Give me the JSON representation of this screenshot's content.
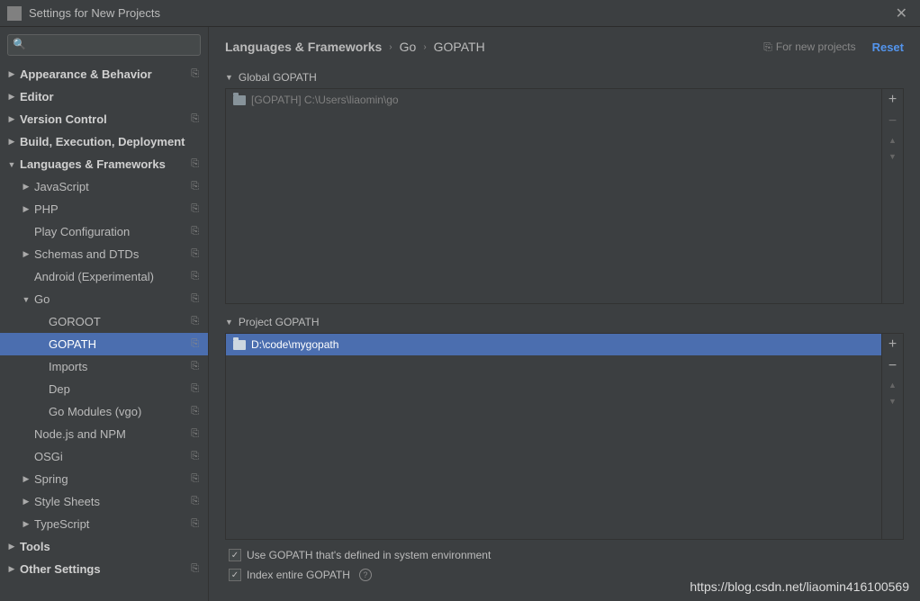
{
  "titlebar": {
    "title": "Settings for New Projects"
  },
  "search": {
    "placeholder": ""
  },
  "tree": [
    {
      "label": "Appearance & Behavior",
      "bold": true,
      "arrow": "▶",
      "indent": 0,
      "copy": true
    },
    {
      "label": "Editor",
      "bold": true,
      "arrow": "▶",
      "indent": 0,
      "copy": false
    },
    {
      "label": "Version Control",
      "bold": true,
      "arrow": "▶",
      "indent": 0,
      "copy": true
    },
    {
      "label": "Build, Execution, Deployment",
      "bold": true,
      "arrow": "▶",
      "indent": 0,
      "copy": false
    },
    {
      "label": "Languages & Frameworks",
      "bold": true,
      "arrow": "▼",
      "indent": 0,
      "copy": true
    },
    {
      "label": "JavaScript",
      "bold": false,
      "arrow": "▶",
      "indent": 1,
      "copy": true
    },
    {
      "label": "PHP",
      "bold": false,
      "arrow": "▶",
      "indent": 1,
      "copy": true
    },
    {
      "label": "Play Configuration",
      "bold": false,
      "arrow": "",
      "indent": 1,
      "copy": true
    },
    {
      "label": "Schemas and DTDs",
      "bold": false,
      "arrow": "▶",
      "indent": 1,
      "copy": true
    },
    {
      "label": "Android (Experimental)",
      "bold": false,
      "arrow": "",
      "indent": 1,
      "copy": true
    },
    {
      "label": "Go",
      "bold": false,
      "arrow": "▼",
      "indent": 1,
      "copy": true
    },
    {
      "label": "GOROOT",
      "bold": false,
      "arrow": "",
      "indent": 2,
      "copy": true
    },
    {
      "label": "GOPATH",
      "bold": false,
      "arrow": "",
      "indent": 2,
      "copy": true,
      "selected": true
    },
    {
      "label": "Imports",
      "bold": false,
      "arrow": "",
      "indent": 2,
      "copy": true
    },
    {
      "label": "Dep",
      "bold": false,
      "arrow": "",
      "indent": 2,
      "copy": true
    },
    {
      "label": "Go Modules (vgo)",
      "bold": false,
      "arrow": "",
      "indent": 2,
      "copy": true
    },
    {
      "label": "Node.js and NPM",
      "bold": false,
      "arrow": "",
      "indent": 1,
      "copy": true
    },
    {
      "label": "OSGi",
      "bold": false,
      "arrow": "",
      "indent": 1,
      "copy": true
    },
    {
      "label": "Spring",
      "bold": false,
      "arrow": "▶",
      "indent": 1,
      "copy": true
    },
    {
      "label": "Style Sheets",
      "bold": false,
      "arrow": "▶",
      "indent": 1,
      "copy": true
    },
    {
      "label": "TypeScript",
      "bold": false,
      "arrow": "▶",
      "indent": 1,
      "copy": true
    },
    {
      "label": "Tools",
      "bold": true,
      "arrow": "▶",
      "indent": 0,
      "copy": false
    },
    {
      "label": "Other Settings",
      "bold": true,
      "arrow": "▶",
      "indent": 0,
      "copy": true
    }
  ],
  "breadcrumb": {
    "p0": "Languages & Frameworks",
    "p1": "Go",
    "p2": "GOPATH"
  },
  "header": {
    "for_new": "For new projects",
    "reset": "Reset"
  },
  "global": {
    "title": "Global GOPATH",
    "items": [
      {
        "label": "[GOPATH] C:\\Users\\liaomin\\go",
        "selected": false
      }
    ]
  },
  "project": {
    "title": "Project GOPATH",
    "items": [
      {
        "label": "D:\\code\\mygopath",
        "selected": true
      }
    ]
  },
  "checks": {
    "use_system": "Use GOPATH that's defined in system environment",
    "index_entire": "Index entire GOPATH"
  },
  "watermark": "https://blog.csdn.net/liaomin416100569"
}
